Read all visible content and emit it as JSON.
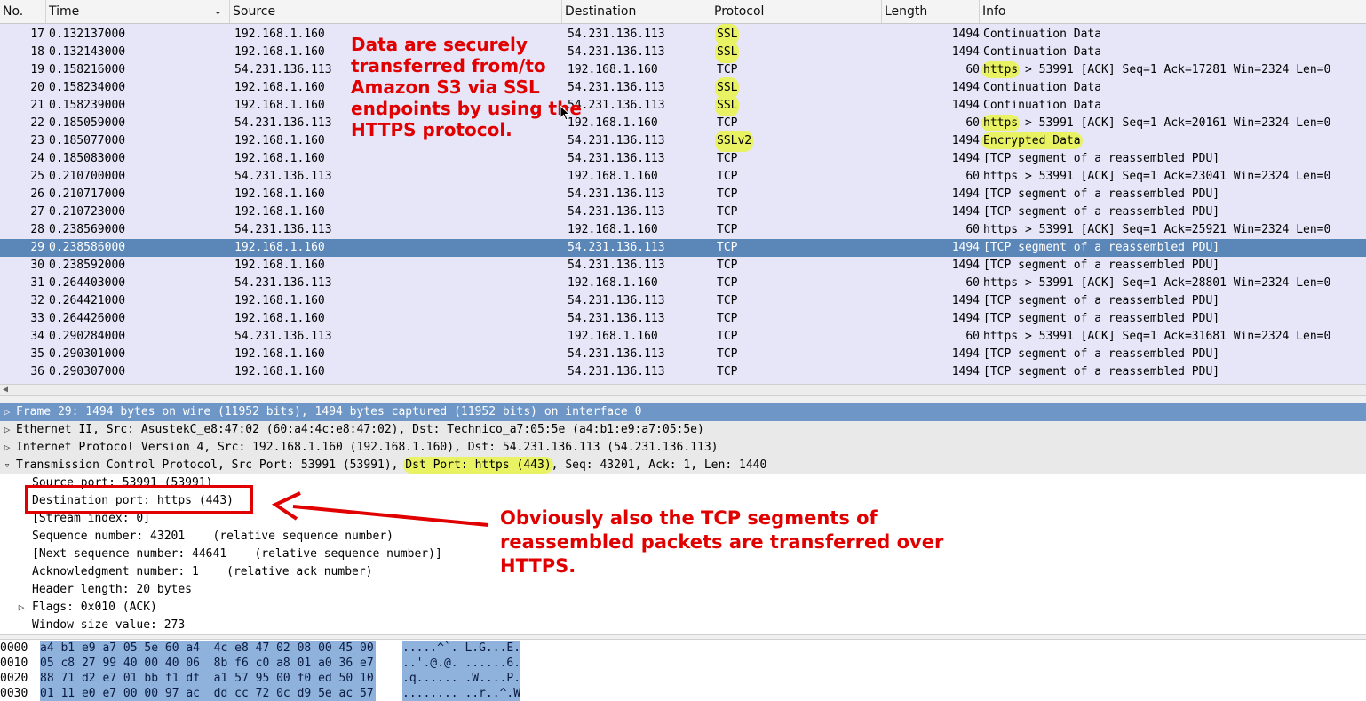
{
  "packet_list": {
    "columns": [
      "No.",
      "Time",
      "Source",
      "Destination",
      "Protocol",
      "Length",
      "Info"
    ],
    "rows": [
      {
        "no": "17",
        "time": "0.132137000",
        "src": "192.168.1.160",
        "dst": "54.231.136.113",
        "proto": "SSL",
        "len": "1494",
        "info_port": "",
        "info": "Continuation Data",
        "hl_proto": true
      },
      {
        "no": "18",
        "time": "0.132143000",
        "src": "192.168.1.160",
        "dst": "54.231.136.113",
        "proto": "SSL",
        "len": "1494",
        "info_port": "",
        "info": "Continuation Data",
        "hl_proto": true
      },
      {
        "no": "19",
        "time": "0.158216000",
        "src": "54.231.136.113",
        "dst": "192.168.1.160",
        "proto": "TCP",
        "len": "60",
        "info_port": "https",
        "info": " > 53991 [ACK] Seq=1 Ack=17281 Win=2324 Len=0",
        "hl_port": true
      },
      {
        "no": "20",
        "time": "0.158234000",
        "src": "192.168.1.160",
        "dst": "54.231.136.113",
        "proto": "SSL",
        "len": "1494",
        "info_port": "",
        "info": "Continuation Data",
        "hl_proto": true
      },
      {
        "no": "21",
        "time": "0.158239000",
        "src": "192.168.1.160",
        "dst": "54.231.136.113",
        "proto": "SSL",
        "len": "1494",
        "info_port": "",
        "info": "Continuation Data",
        "hl_proto": true
      },
      {
        "no": "22",
        "time": "0.185059000",
        "src": "54.231.136.113",
        "dst": "192.168.1.160",
        "proto": "TCP",
        "len": "60",
        "info_port": "https",
        "info": " > 53991 [ACK] Seq=1 Ack=20161 Win=2324 Len=0",
        "hl_port": true
      },
      {
        "no": "23",
        "time": "0.185077000",
        "src": "192.168.1.160",
        "dst": "54.231.136.113",
        "proto": "SSLv2",
        "len": "1494",
        "info_port": "",
        "info": "Encrypted Data",
        "hl_proto": true,
        "hl_info": true
      },
      {
        "no": "24",
        "time": "0.185083000",
        "src": "192.168.1.160",
        "dst": "54.231.136.113",
        "proto": "TCP",
        "len": "1494",
        "info_port": "",
        "info": "[TCP segment of a reassembled PDU]"
      },
      {
        "no": "25",
        "time": "0.210700000",
        "src": "54.231.136.113",
        "dst": "192.168.1.160",
        "proto": "TCP",
        "len": "60",
        "info_port": "",
        "info": "https > 53991 [ACK] Seq=1 Ack=23041 Win=2324 Len=0"
      },
      {
        "no": "26",
        "time": "0.210717000",
        "src": "192.168.1.160",
        "dst": "54.231.136.113",
        "proto": "TCP",
        "len": "1494",
        "info_port": "",
        "info": "[TCP segment of a reassembled PDU]"
      },
      {
        "no": "27",
        "time": "0.210723000",
        "src": "192.168.1.160",
        "dst": "54.231.136.113",
        "proto": "TCP",
        "len": "1494",
        "info_port": "",
        "info": "[TCP segment of a reassembled PDU]"
      },
      {
        "no": "28",
        "time": "0.238569000",
        "src": "54.231.136.113",
        "dst": "192.168.1.160",
        "proto": "TCP",
        "len": "60",
        "info_port": "",
        "info": "https > 53991 [ACK] Seq=1 Ack=25921 Win=2324 Len=0"
      },
      {
        "no": "29",
        "time": "0.238586000",
        "src": "192.168.1.160",
        "dst": "54.231.136.113",
        "proto": "TCP",
        "len": "1494",
        "info_port": "",
        "info": "[TCP segment of a reassembled PDU]",
        "selected": true
      },
      {
        "no": "30",
        "time": "0.238592000",
        "src": "192.168.1.160",
        "dst": "54.231.136.113",
        "proto": "TCP",
        "len": "1494",
        "info_port": "",
        "info": "[TCP segment of a reassembled PDU]"
      },
      {
        "no": "31",
        "time": "0.264403000",
        "src": "54.231.136.113",
        "dst": "192.168.1.160",
        "proto": "TCP",
        "len": "60",
        "info_port": "",
        "info": "https > 53991 [ACK] Seq=1 Ack=28801 Win=2324 Len=0"
      },
      {
        "no": "32",
        "time": "0.264421000",
        "src": "192.168.1.160",
        "dst": "54.231.136.113",
        "proto": "TCP",
        "len": "1494",
        "info_port": "",
        "info": "[TCP segment of a reassembled PDU]"
      },
      {
        "no": "33",
        "time": "0.264426000",
        "src": "192.168.1.160",
        "dst": "54.231.136.113",
        "proto": "TCP",
        "len": "1494",
        "info_port": "",
        "info": "[TCP segment of a reassembled PDU]"
      },
      {
        "no": "34",
        "time": "0.290284000",
        "src": "54.231.136.113",
        "dst": "192.168.1.160",
        "proto": "TCP",
        "len": "60",
        "info_port": "",
        "info": "https > 53991 [ACK] Seq=1 Ack=31681 Win=2324 Len=0"
      },
      {
        "no": "35",
        "time": "0.290301000",
        "src": "192.168.1.160",
        "dst": "54.231.136.113",
        "proto": "TCP",
        "len": "1494",
        "info_port": "",
        "info": "[TCP segment of a reassembled PDU]"
      },
      {
        "no": "36",
        "time": "0.290307000",
        "src": "192.168.1.160",
        "dst": "54.231.136.113",
        "proto": "TCP",
        "len": "1494",
        "info_port": "",
        "info": "[TCP segment of a reassembled PDU]"
      }
    ]
  },
  "details": {
    "frame": "Frame 29: 1494 bytes on wire (11952 bits), 1494 bytes captured (11952 bits) on interface 0",
    "ethernet": "Ethernet II, Src: AsustekC_e8:47:02 (60:a4:4c:e8:47:02), Dst: Technico_a7:05:5e (a4:b1:e9:a7:05:5e)",
    "ip": "Internet Protocol Version 4, Src: 192.168.1.160 (192.168.1.160), Dst: 54.231.136.113 (54.231.136.113)",
    "tcp_prefix": "Transmission Control Protocol, Src Port: 53991 (53991), ",
    "tcp_dst": "Dst Port: https (443)",
    "tcp_suffix": ", Seq: 43201, Ack: 1, Len: 1440",
    "fields": [
      "Source port: 53991 (53991)",
      "Destination port: https (443)",
      "[Stream index: 0]",
      "Sequence number: 43201    (relative sequence number)",
      "[Next sequence number: 44641    (relative sequence number)]",
      "Acknowledgment number: 1    (relative ack number)",
      "Header length: 20 bytes",
      "Flags: 0x010 (ACK)",
      "Window size value: 273"
    ]
  },
  "bytes": [
    {
      "offset": "0000",
      "hex": "a4 b1 e9 a7 05 5e 60 a4  4c e8 47 02 08 00 45 00",
      "ascii": ".....^`. L.G...E."
    },
    {
      "offset": "0010",
      "hex": "05 c8 27 99 40 00 40 06  8b f6 c0 a8 01 a0 36 e7",
      "ascii": "..'.@.@. ......6."
    },
    {
      "offset": "0020",
      "hex": "88 71 d2 e7 01 bb f1 df  a1 57 95 00 f0 ed 50 10",
      "ascii": ".q...... .W....P."
    },
    {
      "offset": "0030",
      "hex": "01 11 e0 e7 00 00 97 ac  dd cc 72 0c d9 5e ac 57",
      "ascii": "........ ..r..^.W"
    }
  ],
  "annotations": {
    "top": "Data are securely transferred  from/to Amazon S3 via SSL endpoints by using the HTTPS protocol.",
    "bottom": "Obviously also the TCP segments of reassembled packets are transferred over HTTPS."
  },
  "icons": {
    "sort": "sort-arrow-icon",
    "expand": "triangle-right-icon",
    "collapse": "triangle-down-icon"
  },
  "colors": {
    "highlight": "#e8f262",
    "annotation": "#e00000",
    "selected_row": "#5a86b8"
  }
}
